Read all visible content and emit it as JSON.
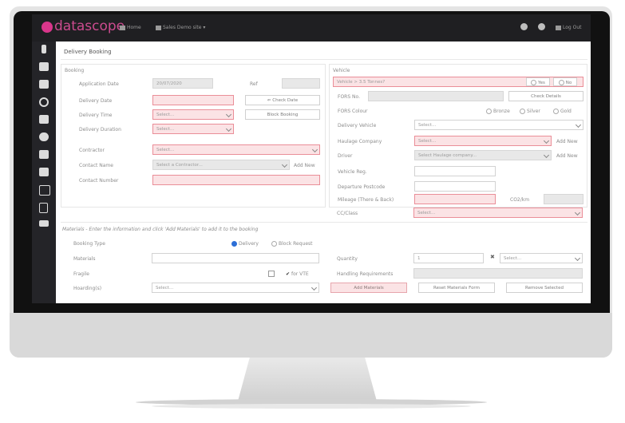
{
  "app": {
    "brand": "datascope",
    "nav_home": "Home",
    "nav_site": "Sales Demo site ▾",
    "logout": "Log Out"
  },
  "page": {
    "title": "Delivery Booking"
  },
  "booking": {
    "header": "Booking",
    "application_date_label": "Application Date",
    "application_date_value": "20/07/2020",
    "ref_label": "Ref",
    "delivery_date_label": "Delivery Date",
    "check_date_button": "⇐ Check Date",
    "delivery_time_label": "Delivery Time",
    "delivery_time_value": "Select...",
    "block_booking_button": "Block Booking",
    "delivery_duration_label": "Delivery Duration",
    "delivery_duration_value": "Select...",
    "contractor_label": "Contractor",
    "contractor_value": "Select...",
    "contact_name_label": "Contact Name",
    "contact_name_value": "Select a Contractor...",
    "add_new": "Add New",
    "contact_number_label": "Contact Number"
  },
  "vehicle": {
    "header": "Vehicle",
    "over_label": "Vehicle > 3.5 Tonnes?",
    "yes": "Yes",
    "no": "No",
    "fors_label": "FORS No.",
    "check_details_button": "Check Details",
    "fors_colour_label": "FORS Colour",
    "bronze": "Bronze",
    "silver": "Silver",
    "gold": "Gold",
    "delivery_vehicle_label": "Delivery Vehicle",
    "delivery_vehicle_value": "Select...",
    "haulage_label": "Haulage Company",
    "haulage_value": "Select...",
    "haulage_add": "Add New",
    "driver_label": "Driver",
    "driver_value": "Select Haulage company...",
    "driver_add": "Add New",
    "reg_label": "Vehicle Reg.",
    "depart_label": "Departure Postcode",
    "mileage_label": "Mileage (There & Back)",
    "co2_label": "CO2/km",
    "cc_label": "CC/Class",
    "cc_value": "Select..."
  },
  "materials": {
    "hint": "Materials - Enter the information and click 'Add Materials' to add it to the booking",
    "booking_type_label": "Booking Type",
    "delivery_option": "Delivery",
    "block_option": "Block Request",
    "materials_label": "Materials",
    "quantity_label": "Quantity",
    "quantity_value": "1",
    "unit_value": "Select...",
    "fragile_label": "Fragile",
    "for_vte": "for VTE",
    "handling_label": "Handling Requirements",
    "hoarding_label": "Hoarding(s)",
    "hoarding_value": "Select...",
    "add_materials": "Add Materials",
    "reset_materials": "Reset Materials Form",
    "remove_selected": "Remove Selected"
  },
  "colors": {
    "accent": "#cc4b8f",
    "required_fill": "#fbe3e5",
    "required_border": "#ea8e98",
    "topbar": "#1f1f22"
  }
}
